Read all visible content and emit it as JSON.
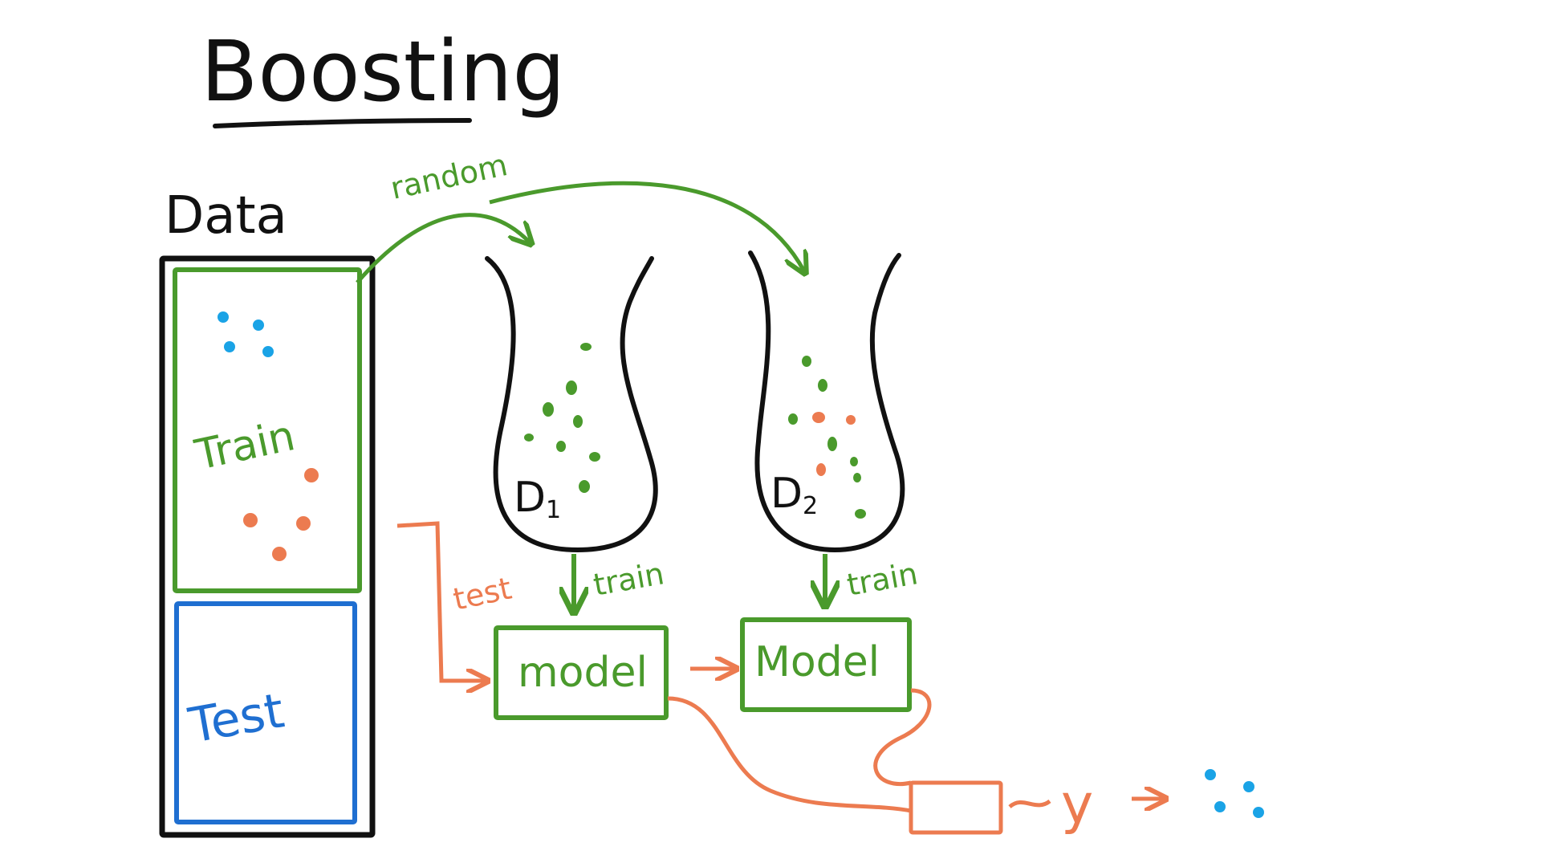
{
  "title": "Boosting",
  "data_label": "Data",
  "train_label": "Train",
  "test_label": "Test",
  "random_label": "random",
  "test_arrow_label": "test",
  "d1_label": "D",
  "d1_sub": "1",
  "d2_label": "D",
  "d2_sub": "2",
  "train_arrow_1": "train",
  "train_arrow_2": "train",
  "model_1": "model",
  "model_2": "Model",
  "output_y": "y",
  "colors": {
    "ink": "#111111",
    "green": "#4a9a2c",
    "blue": "#1f6fd1",
    "orange": "#ec7b50",
    "dot_blue": "#1aa3e6"
  }
}
